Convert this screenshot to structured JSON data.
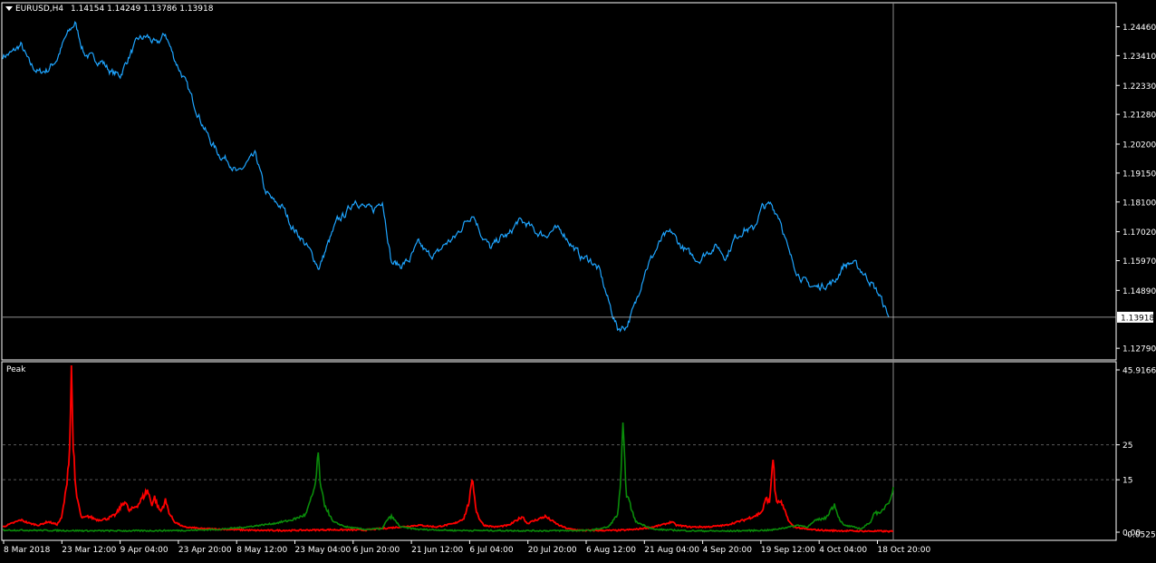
{
  "main_window": {
    "symbol_label": "EURUSD,H4",
    "ohlc_label": "1.14154 1.14249 1.13786 1.13918",
    "current_price_label": "1.13918"
  },
  "indicator_window": {
    "name": "Peak"
  },
  "colors": {
    "background": "#000000",
    "price_line": "#1EA5FF",
    "indicator_red": "#FF0000",
    "indicator_green": "#0A8C0A",
    "frame": "#FFFFFF",
    "level_line": "#5A5A5A"
  },
  "icons": {
    "menu": "triangle-down-icon"
  },
  "chart_data": [
    {
      "type": "line",
      "name": "main-price-chart",
      "ylim": [
        1.124,
        1.253
      ],
      "y_ticks": [
        1.2446,
        1.2341,
        1.2233,
        1.2128,
        1.202,
        1.1915,
        1.181,
        1.1702,
        1.1597,
        1.1489,
        1.1279
      ],
      "y_tick_labels": [
        "1.24460",
        "1.23410",
        "1.22330",
        "1.21280",
        "1.20200",
        "1.19150",
        "1.18100",
        "1.17020",
        "1.15970",
        "1.14890",
        "1.12790"
      ],
      "current_price": 1.13918,
      "grid": false,
      "series": [
        {
          "x": [
            0,
            10,
            20,
            30,
            40,
            50,
            60,
            70,
            80,
            90,
            100,
            110,
            120,
            130,
            140,
            150,
            160,
            170,
            180,
            190,
            200,
            210,
            220,
            230,
            240,
            250,
            260,
            270,
            280,
            290,
            300,
            310,
            320,
            330,
            340,
            350,
            360,
            370,
            380,
            390,
            400,
            410,
            420,
            430,
            440,
            450,
            460,
            470,
            480,
            490,
            500,
            510,
            520,
            530,
            540,
            550,
            560,
            570,
            580,
            590,
            600,
            610,
            620,
            630,
            640,
            650,
            660,
            670,
            680,
            690,
            700,
            710,
            720,
            730,
            740,
            750,
            760,
            770,
            780,
            790,
            800,
            810,
            820,
            830,
            840,
            850,
            860,
            870,
            880,
            890,
            900,
            910,
            920,
            930,
            940,
            950,
            960,
            970,
            980
          ],
          "values": [
            1.234,
            1.235,
            1.238,
            1.231,
            1.228,
            1.229,
            1.233,
            1.241,
            1.246,
            1.235,
            1.233,
            1.232,
            1.228,
            1.227,
            1.234,
            1.24,
            1.241,
            1.238,
            1.242,
            1.233,
            1.226,
            1.218,
            1.21,
            1.203,
            1.198,
            1.196,
            1.191,
            1.195,
            1.198,
            1.185,
            1.181,
            1.179,
            1.172,
            1.168,
            1.163,
            1.157,
            1.166,
            1.174,
            1.177,
            1.182,
            1.179,
            1.178,
            1.182,
            1.159,
            1.158,
            1.16,
            1.166,
            1.162,
            1.162,
            1.166,
            1.168,
            1.173,
            1.177,
            1.169,
            1.164,
            1.168,
            1.169,
            1.174,
            1.173,
            1.17,
            1.169,
            1.171,
            1.17,
            1.165,
            1.161,
            1.16,
            1.156,
            1.145,
            1.135,
            1.136,
            1.144,
            1.156,
            1.162,
            1.168,
            1.17,
            1.165,
            1.162,
            1.16,
            1.163,
            1.165,
            1.161,
            1.168,
            1.171,
            1.171,
            1.179,
            1.18,
            1.175,
            1.162,
            1.155,
            1.151,
            1.15,
            1.151,
            1.152,
            1.158,
            1.159,
            1.156,
            1.152,
            1.147,
            1.1392
          ]
        }
      ]
    },
    {
      "type": "line",
      "name": "peak-indicator",
      "ylim": [
        0,
        45.9166
      ],
      "y_ticks": [
        45.9166,
        25,
        15,
        0
      ],
      "y_tick_labels": [
        "45.9166",
        "25",
        "15",
        "0.00"
      ],
      "bottom_tick_overlap_label": "-0.0525",
      "levels": [
        25,
        15
      ],
      "x_tick_labels": [
        "8 Mar 2018",
        "23 Mar 12:00",
        "9 Apr 04:00",
        "23 Apr 20:00",
        "8 May 12:00",
        "23 May 04:00",
        "6 Jun 20:00",
        "21 Jun 12:00",
        "6 Jul 04:00",
        "20 Jul 20:00",
        "6 Aug 12:00",
        "21 Aug 04:00",
        "4 Sep 20:00",
        "19 Sep 12:00",
        "4 Oct 04:00",
        "18 Oct 20:00"
      ],
      "series": [
        {
          "color": "#FF0000",
          "x": [
            0,
            10,
            20,
            30,
            40,
            50,
            60,
            65,
            70,
            74,
            76,
            78,
            80,
            82,
            84,
            86,
            88,
            95,
            105,
            115,
            125,
            135,
            140,
            145,
            150,
            155,
            160,
            165,
            168,
            172,
            175,
            180,
            185,
            190,
            200,
            220,
            250,
            280,
            320,
            360,
            400,
            440,
            460,
            480,
            500,
            510,
            515,
            520,
            522,
            524,
            527,
            532,
            545,
            560,
            575,
            580,
            585,
            600,
            615,
            625,
            640,
            660,
            680,
            700,
            720,
            735,
            740,
            745,
            760,
            780,
            800,
            820,
            835,
            840,
            845,
            848,
            852,
            854,
            857,
            860,
            865,
            870,
            875,
            890,
            910,
            930,
            950,
            970,
            985
          ],
          "values": [
            1.5,
            2.5,
            3.5,
            2.5,
            2.0,
            3.0,
            2.2,
            4.0,
            12.0,
            24.0,
            45.9,
            26.0,
            14.0,
            10.0,
            8.0,
            5.0,
            4.0,
            4.5,
            3.5,
            3.8,
            5.0,
            9.0,
            6.0,
            7.0,
            8.0,
            10.0,
            12.0,
            8.0,
            10.0,
            7.0,
            6.0,
            9.0,
            5.0,
            3.0,
            1.5,
            1.0,
            0.8,
            0.5,
            0.5,
            0.7,
            0.6,
            1.5,
            2.0,
            1.5,
            2.5,
            4.0,
            8.0,
            15.0,
            10.0,
            6.0,
            4.0,
            2.0,
            1.5,
            2.0,
            4.5,
            2.5,
            3.0,
            4.5,
            2.0,
            1.0,
            0.5,
            0.5,
            0.5,
            0.8,
            1.5,
            2.5,
            3.0,
            2.0,
            1.5,
            1.5,
            2.0,
            3.5,
            5.0,
            6.0,
            10.0,
            8.0,
            22.0,
            12.0,
            8.0,
            9.0,
            6.0,
            3.0,
            1.5,
            0.8,
            0.5,
            0.4,
            0.3,
            0.3,
            0.2
          ]
        },
        {
          "color": "#0A8C0A",
          "x": [
            0,
            50,
            100,
            150,
            200,
            240,
            270,
            300,
            320,
            335,
            342,
            346,
            349,
            352,
            356,
            365,
            380,
            400,
            420,
            425,
            430,
            440,
            460,
            500,
            600,
            650,
            670,
            680,
            683,
            686,
            690,
            700,
            720,
            760,
            800,
            850,
            870,
            880,
            890,
            900,
            910,
            915,
            920,
            925,
            930,
            950,
            960,
            965,
            970,
            975,
            980,
            985
          ],
          "values": [
            0.6,
            0.5,
            0.4,
            0.4,
            0.5,
            0.8,
            1.5,
            2.5,
            3.5,
            5.0,
            10.0,
            14.0,
            22.0,
            12.0,
            8.0,
            3.0,
            1.5,
            0.8,
            1.0,
            3.5,
            4.5,
            1.5,
            0.8,
            0.5,
            0.4,
            0.5,
            1.5,
            5.0,
            12.0,
            29.0,
            11.0,
            3.0,
            0.8,
            0.4,
            0.3,
            0.6,
            1.5,
            2.0,
            1.5,
            3.5,
            4.0,
            6.0,
            8.0,
            4.0,
            2.0,
            1.0,
            3.0,
            6.0,
            5.0,
            7.0,
            9.0,
            12.0
          ]
        }
      ]
    }
  ]
}
